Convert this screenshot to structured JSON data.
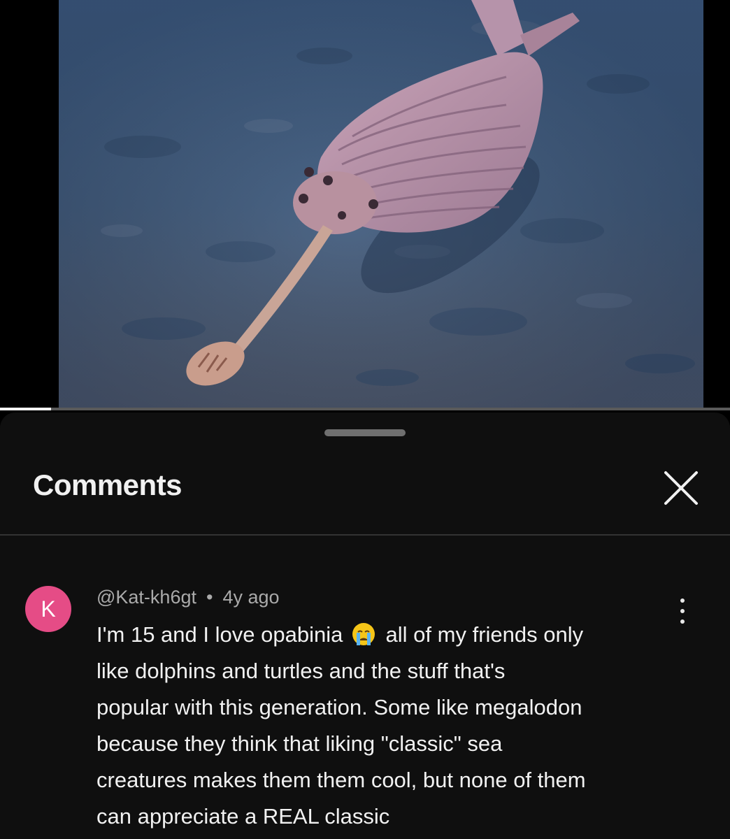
{
  "video": {
    "progress_fraction": 0.07,
    "thumbnail_icon": "opabinia-seafloor-illustration"
  },
  "comments_panel": {
    "title": "Comments",
    "close_icon": "close-icon"
  },
  "comment": {
    "avatar_letter": "K",
    "avatar_color": "#e54c86",
    "author": "@Kat-kh6gt",
    "separator": "•",
    "time": "4y ago",
    "emoji_icon": "crying-face-icon",
    "lines": [
      {
        "before": "I'm 15 and I love opabinia",
        "after": "all of my friends only"
      },
      {
        "text": "like dolphins and turtles and the stuff that's"
      },
      {
        "text": "popular with this generation. Some like megalodon"
      },
      {
        "text": "because they think that liking \"classic\" sea"
      },
      {
        "text": "creatures makes them them cool, but none of them"
      },
      {
        "text": "can appreciate a REAL classic"
      }
    ],
    "menu_icon": "more-vert-icon"
  }
}
